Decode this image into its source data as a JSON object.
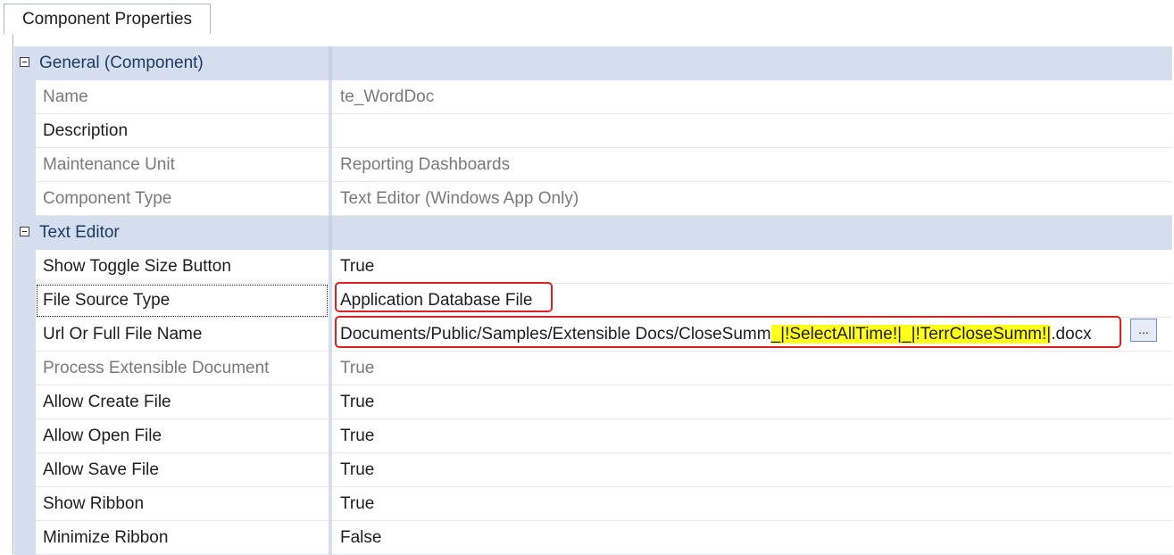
{
  "tab": {
    "label": "Component Properties"
  },
  "categories": [
    {
      "label": "General (Component)",
      "properties": [
        {
          "name": "Name",
          "value": "te_WordDoc",
          "readonly": true
        },
        {
          "name": "Description",
          "value": "",
          "readonly": false
        },
        {
          "name": "Maintenance Unit",
          "value": "Reporting Dashboards",
          "readonly": true
        },
        {
          "name": "Component Type",
          "value": "Text Editor (Windows App Only)",
          "readonly": true
        }
      ]
    },
    {
      "label": "Text Editor",
      "properties": [
        {
          "name": "Show Toggle Size Button",
          "value": "True",
          "readonly": false
        },
        {
          "name": "File Source Type",
          "value": "Application Database File",
          "readonly": false
        },
        {
          "name": "Url Or Full File Name",
          "value_parts": [
            "Documents/Public/Samples/Extensible Docs/CloseSumm",
            "_|!SelectAllTime!|_|!TerrCloseSumm!|",
            ".docx"
          ],
          "readonly": false
        },
        {
          "name": "Process Extensible Document",
          "value": "True",
          "readonly": true
        },
        {
          "name": "Allow Create File",
          "value": "True",
          "readonly": false
        },
        {
          "name": "Allow Open File",
          "value": "True",
          "readonly": false
        },
        {
          "name": "Allow Save File",
          "value": "True",
          "readonly": false
        },
        {
          "name": "Show Ribbon",
          "value": "True",
          "readonly": false
        },
        {
          "name": "Minimize Ribbon",
          "value": "False",
          "readonly": false
        }
      ]
    }
  ],
  "browse_button": {
    "label": "..."
  },
  "colors": {
    "category_background": "#d4deef",
    "category_text": "#1f3a64",
    "annotation_red": "#e02020",
    "highlight_yellow": "#ffff1a"
  }
}
